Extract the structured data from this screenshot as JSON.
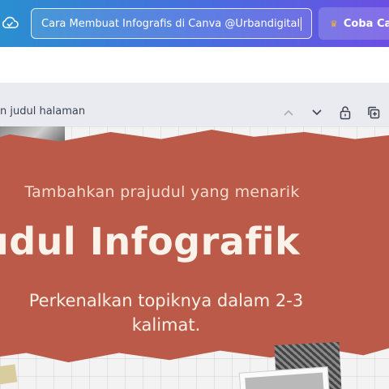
{
  "header": {
    "design_title": "Cara Membuat Infografis di Canva @Urbandigital",
    "cta_label": "Coba Ca",
    "cloud_icon": "cloud-check-icon",
    "crown_icon": "crown-icon",
    "crown_color": "#f5b82e"
  },
  "page": {
    "title_placeholder": "n judul halaman",
    "icons": [
      "chevron-up-icon",
      "chevron-down-icon",
      "lock-icon",
      "duplicate-icon"
    ]
  },
  "canvas": {
    "subtitle": "Tambahkan prajudul yang menarik",
    "headline": "udul Infografik",
    "body_line1": "Perkenalkan topiknya dalam 2-3",
    "body_line2": "kalimat.",
    "accent_color": "#bb5a49"
  }
}
